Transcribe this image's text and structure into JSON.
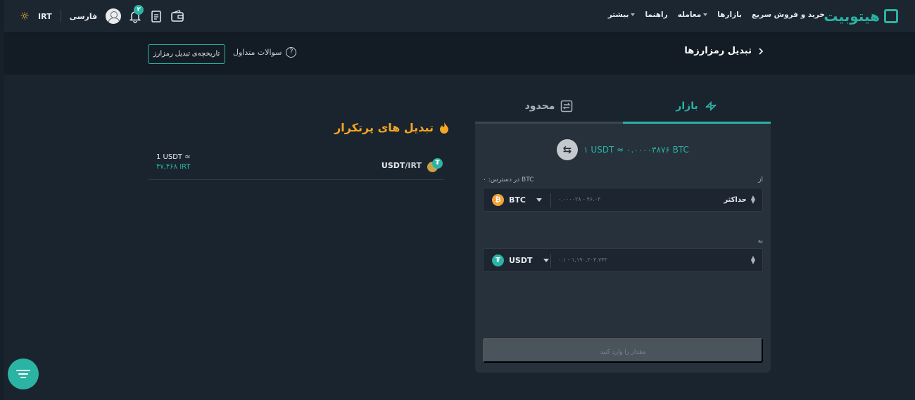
{
  "header": {
    "logo_text": "هیتوبیت",
    "nav": [
      {
        "label": "خرید و فروش سریع",
        "has_caret": false
      },
      {
        "label": "بازارها",
        "has_caret": false
      },
      {
        "label": "معامله",
        "has_caret": true
      },
      {
        "label": "راهنما",
        "has_caret": false
      },
      {
        "label": "بیشتر",
        "has_caret": true
      }
    ],
    "currency": "IRT",
    "language": "فارسی",
    "notification_count": "۲",
    "icons": [
      "sun-icon",
      "avatar-icon",
      "bell-icon",
      "clipboard-icon",
      "wallet-icon"
    ]
  },
  "subheader": {
    "title": "تبدیل رمزارزها",
    "faq_label": "سوالات متداول",
    "history_button": "تاریخچه‌ی تبدیل رمزارز"
  },
  "converter": {
    "tabs": [
      {
        "label": "بازار",
        "icon": "swap-arrows-icon",
        "active": true
      },
      {
        "label": "محدود",
        "icon": "limit-swap-icon",
        "active": false
      }
    ],
    "rate": "۱ USDT ≈ ۰.۰۰۰۰۳۸۷۶ BTC",
    "from": {
      "label": "از",
      "balance": "در دسترس: ۰ BTC",
      "coin": "BTC",
      "range_placeholder": "۰.۰۰۰۰۲۸ - ۴۶.۰۳",
      "max_label": "حداکثر"
    },
    "to": {
      "label": "به",
      "coin": "USDT",
      "range_placeholder": "۰.۱ - ۱,۱۹۰,۲۰۴.۷۴۳"
    },
    "submit_label": "مقدار را وارد کنید"
  },
  "popular": {
    "title": "تبدیل های پرتکرار",
    "items": [
      {
        "base": "USDT",
        "quote": "IRT",
        "rate_prefix": "1 USDT ≈",
        "rate_value": "۴۷,۴۶۸ IRT"
      }
    ]
  },
  "colors": {
    "accent": "#2bb3a3",
    "warning": "#f5a623",
    "background": "#16202a"
  }
}
